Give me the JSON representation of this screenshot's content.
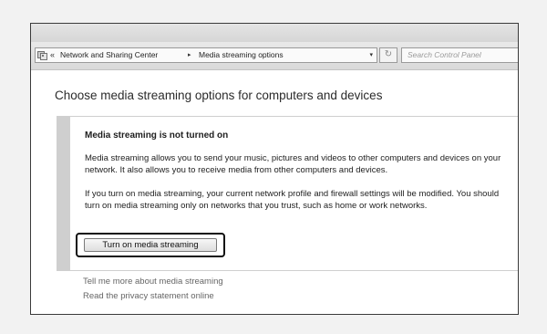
{
  "address_bar": {
    "breadcrumbs": [
      "Network and Sharing Center",
      "Media streaming options"
    ],
    "back_glyph": "«",
    "separator_glyph": "▸",
    "dropdown_glyph": "▾",
    "refresh_glyph": "↻",
    "icon": "control-panel-icon"
  },
  "search": {
    "placeholder": "Search Control Panel"
  },
  "page": {
    "title": "Choose media streaming options for computers and devices"
  },
  "panel": {
    "heading": "Media streaming is not turned on",
    "paragraph1": "Media streaming allows you to send your music, pictures and videos to other computers and devices on your network.  It also allows you to receive media from other computers and devices.",
    "paragraph2": "If you turn on media streaming, your current network profile and firewall settings will be modified. You should turn on media streaming only on networks that you trust, such as home or work networks.",
    "button_label": "Turn on media streaming"
  },
  "links": [
    "Tell me more about media streaming",
    "Read the privacy statement online"
  ]
}
